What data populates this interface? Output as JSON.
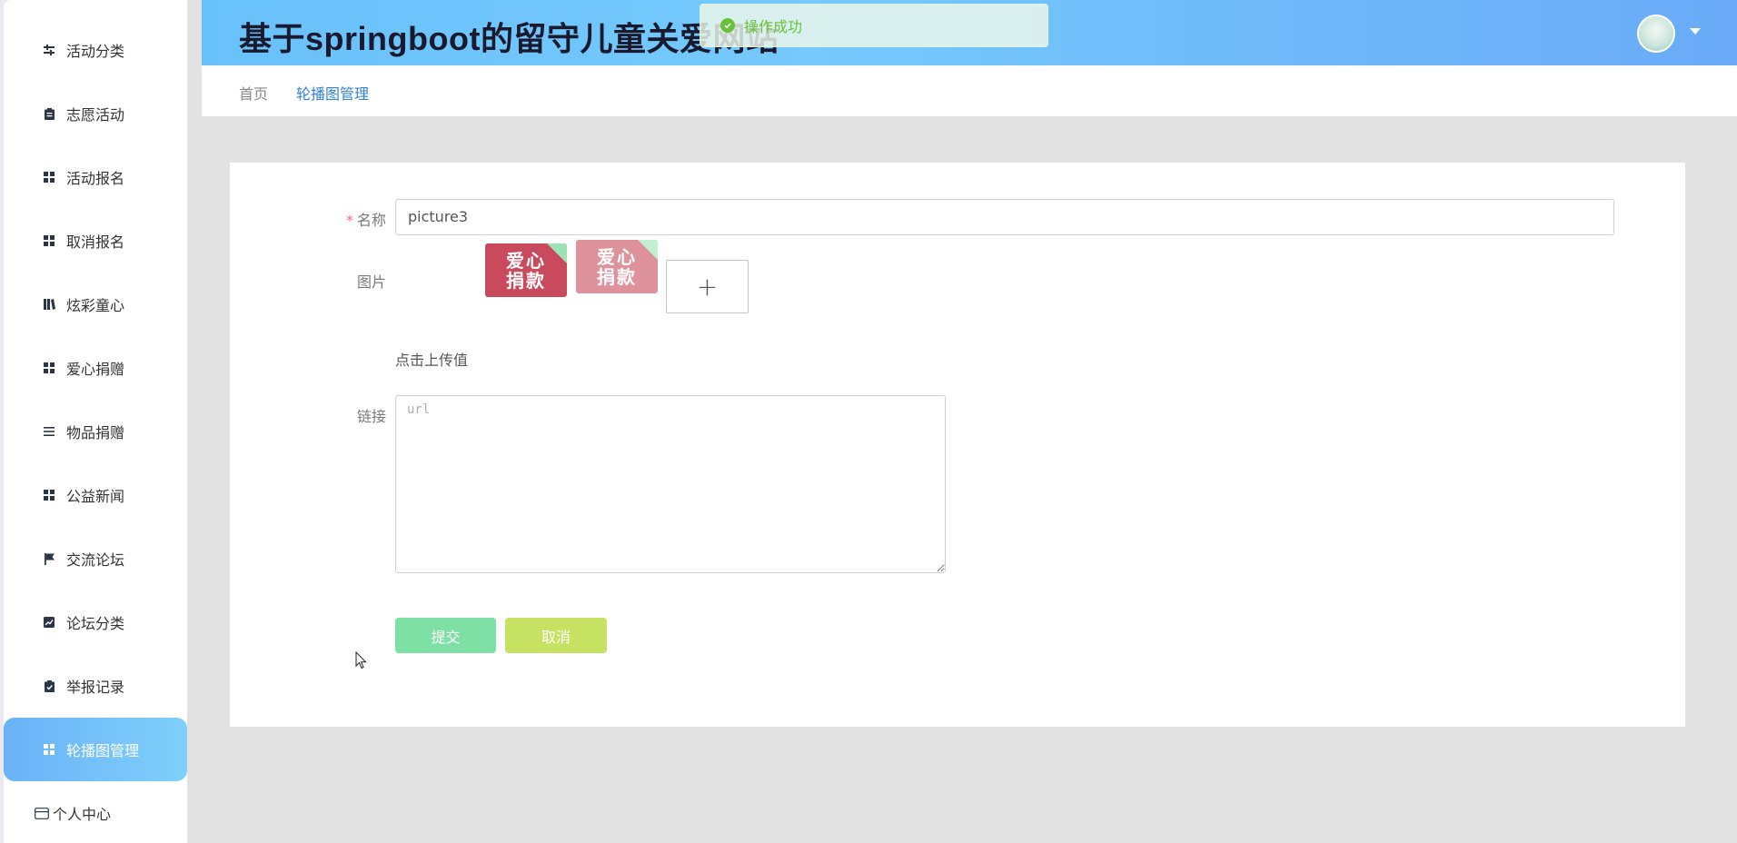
{
  "header": {
    "site_title": "基于springboot的留守儿童关爱网站",
    "toast_message": "操作成功",
    "accent": "#6ab4f9"
  },
  "sidebar": {
    "items": [
      {
        "label": "活动分类",
        "icon": "sliders-icon"
      },
      {
        "label": "志愿活动",
        "icon": "clipboard-icon"
      },
      {
        "label": "活动报名",
        "icon": "grid-icon"
      },
      {
        "label": "取消报名",
        "icon": "grid-icon"
      },
      {
        "label": "炫彩童心",
        "icon": "book-icon"
      },
      {
        "label": "爱心捐赠",
        "icon": "grid-icon"
      },
      {
        "label": "物品捐赠",
        "icon": "list-icon"
      },
      {
        "label": "公益新闻",
        "icon": "grid-icon"
      },
      {
        "label": "交流论坛",
        "icon": "flag-icon"
      },
      {
        "label": "论坛分类",
        "icon": "chart-icon"
      },
      {
        "label": "举报记录",
        "icon": "clipboard-check-icon"
      },
      {
        "label": "轮播图管理",
        "icon": "grid-icon",
        "active": true
      },
      {
        "label": "个人中心",
        "icon": "card-icon"
      }
    ]
  },
  "breadcrumb": {
    "home": "首页",
    "current": "轮播图管理"
  },
  "form": {
    "name_label": "名称",
    "required_mark": "*",
    "name_value": "picture3",
    "image_label": "图片",
    "thumb_text_line1": "爱心",
    "thumb_text_line2": "捐款",
    "upload_plus": "+",
    "upload_hint": "点击上传值",
    "link_label": "链接",
    "link_placeholder": "url",
    "submit_label": "提交",
    "cancel_label": "取消"
  }
}
